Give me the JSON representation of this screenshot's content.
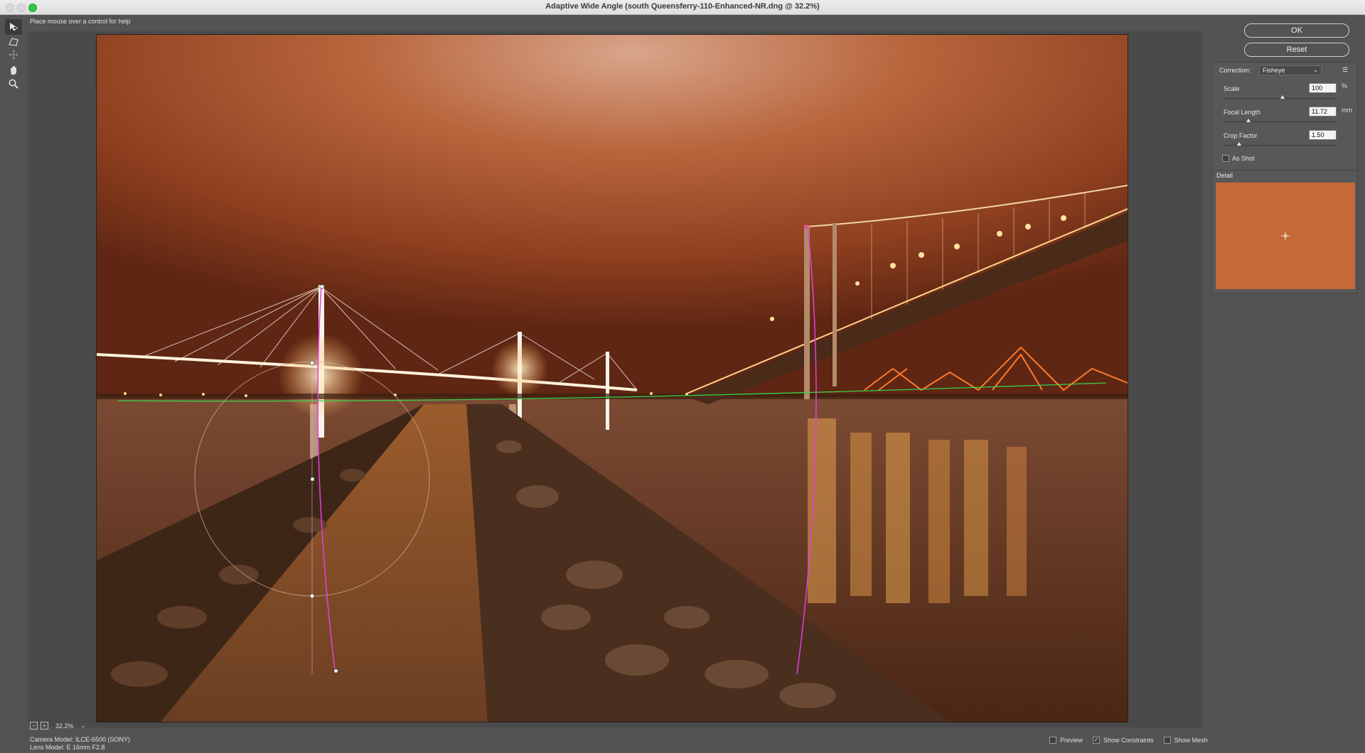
{
  "window": {
    "title": "Adaptive Wide Angle (south Queensferry-110-Enhanced-NR.dng @ 32.2%)"
  },
  "tools": [
    {
      "name": "constraint-tool",
      "icon": "arrow-constraint-icon"
    },
    {
      "name": "polygon-constraint-tool",
      "icon": "polygon-icon"
    },
    {
      "name": "move-tool",
      "icon": "move-icon"
    },
    {
      "name": "hand-tool",
      "icon": "hand-icon"
    },
    {
      "name": "zoom-tool",
      "icon": "magnifier-icon"
    }
  ],
  "help_text": "Place mouse over a control for help",
  "zoom": {
    "minus": "−",
    "plus": "+",
    "level": "32.2%",
    "menu": "⌄"
  },
  "camera": {
    "model": "Camera Model: ILCE-6500 (SONY)",
    "lens": "Lens Model: E 16mm F2.8"
  },
  "bottom_options": [
    {
      "label": "Preview",
      "checked": false
    },
    {
      "label": "Show Constraints",
      "checked": true
    },
    {
      "label": "Show Mesh",
      "checked": false
    }
  ],
  "buttons": {
    "ok": "OK",
    "reset": "Reset"
  },
  "correction": {
    "label": "Correction:",
    "value": "Fisheye",
    "menu_icon": "☰"
  },
  "params": {
    "scale": {
      "label": "Scale",
      "value": "100",
      "unit": "%"
    },
    "focal_length": {
      "label": "Focal Length",
      "value": "11.72",
      "unit": "mm"
    },
    "crop_factor": {
      "label": "Crop Factor",
      "value": "1.50",
      "unit": ""
    }
  },
  "as_shot": {
    "label": "As Shot",
    "checked": false
  },
  "detail": {
    "label": "Detail"
  },
  "colors": {
    "panel_bg": "#535353",
    "detail_swatch": "#c46a36",
    "constraint_magenta": "#e33fe0",
    "constraint_green": "#37d14b"
  }
}
